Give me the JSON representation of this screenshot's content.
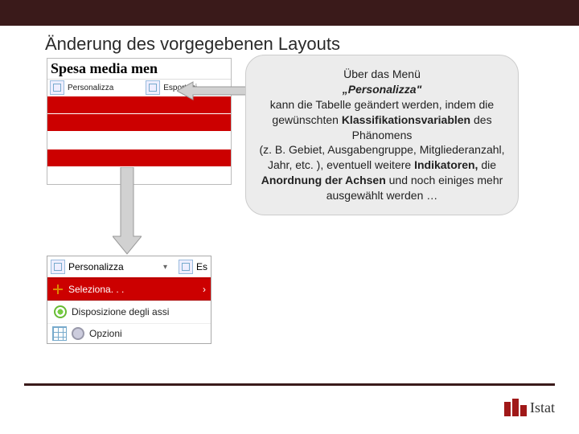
{
  "slide": {
    "title": "Änderung des vorgegebenen Layouts"
  },
  "table_preview": {
    "header": "Spesa media men",
    "toolbar": {
      "personalizza": "Personalizza",
      "esportazioni": "Esportazi"
    }
  },
  "callout": {
    "line1": "Über das Menü",
    "menu_name": "„Personalizza\"",
    "line2a": "kann die Tabelle geändert werden, indem die gewünschten ",
    "kw1": "Klassifikationsvariablen",
    "line2b": " des Phänomens",
    "line3": "(z. B. Gebiet, Ausgabengruppe, Mitgliederanzahl, Jahr, etc. ), eventuell weitere ",
    "kw2": "Indikatoren,",
    "line4a": " die ",
    "kw3": "Anordnung der Achsen",
    "line4b": " und noch einiges mehr ausgewählt werden …"
  },
  "menu": {
    "personalizza": "Personalizza",
    "es": "Es",
    "seleziona": "Seleziona. . .",
    "disposizione": "Disposizione degli assi",
    "opzioni": "Opzioni"
  },
  "logo": {
    "text": "Istat"
  }
}
